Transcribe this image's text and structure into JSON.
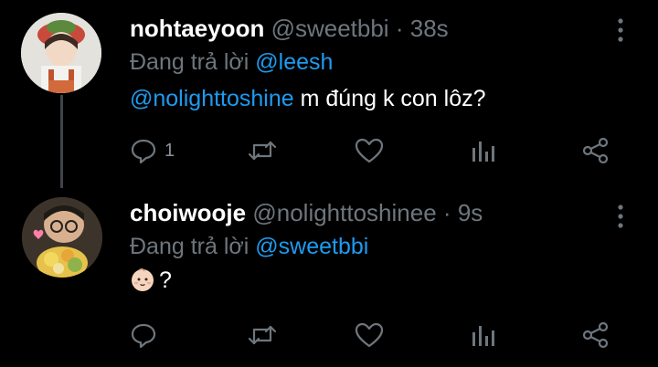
{
  "tweets": [
    {
      "name": "nohtaeyoon",
      "handle": "@sweetbbi",
      "separator": "·",
      "time": "38s",
      "reply_prefix": "Đang trả lời",
      "reply_to": "@leesh",
      "body_mention": "@nolighttoshine",
      "body_text": " m đúng k con lôz?",
      "reply_count": "1"
    },
    {
      "name": "choiwooje",
      "handle": "@nolighttoshinee",
      "separator": "·",
      "time": "9s",
      "reply_prefix": "Đang trả lời",
      "reply_to": "@sweetbbi",
      "body_text": "?",
      "body_emoji": "baby-face-icon",
      "reply_count": ""
    }
  ],
  "colors": {
    "background": "#000000",
    "text": "#e7e9ea",
    "muted": "#6e767d",
    "link": "#1d9bf0",
    "thread_line": "#404448"
  },
  "icons": [
    "reply-icon",
    "retweet-icon",
    "like-icon",
    "views-icon",
    "share-icon",
    "more-vertical-icon"
  ]
}
